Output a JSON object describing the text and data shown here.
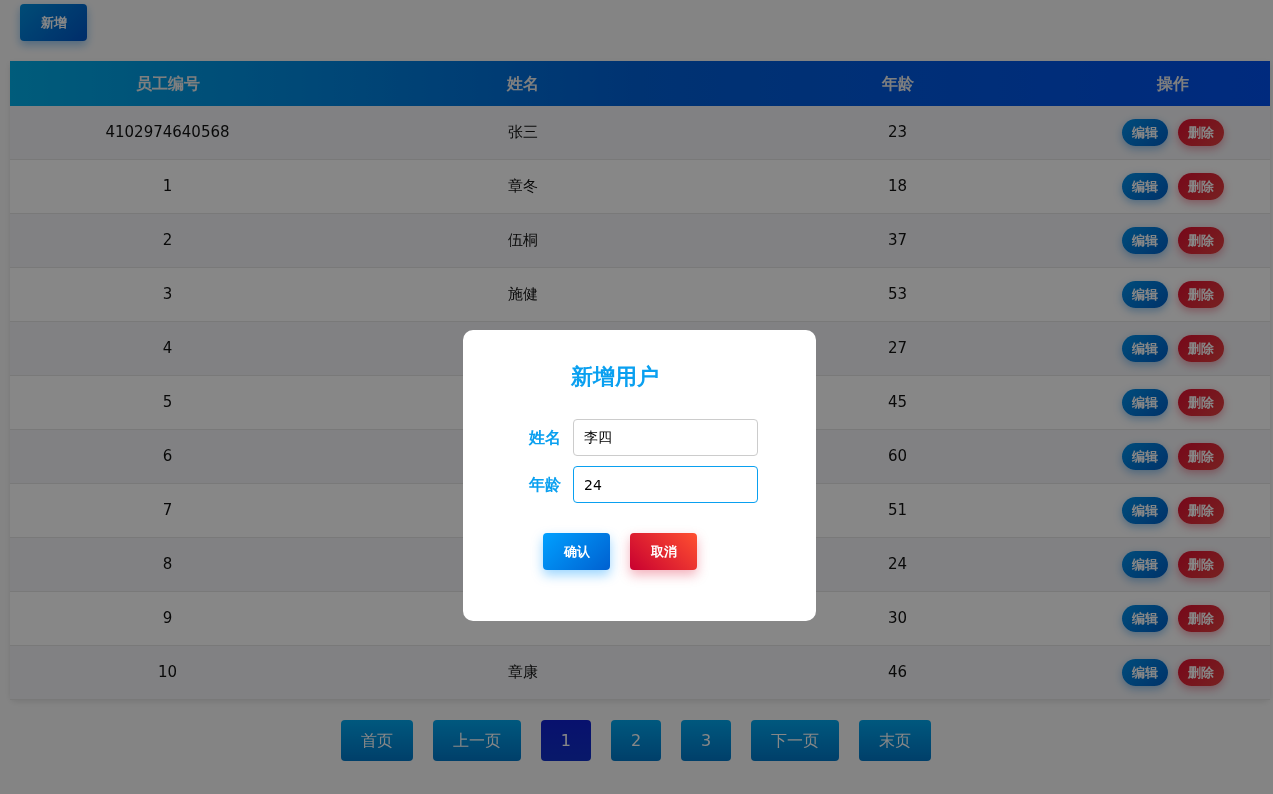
{
  "add_button": "新增",
  "table": {
    "columns": [
      "员工编号",
      "姓名",
      "年龄",
      "操作"
    ],
    "rows": [
      {
        "id": "4102974640568",
        "name": "张三",
        "age": "23",
        "actions": [
          "编辑",
          "删除"
        ]
      },
      {
        "id": "1",
        "name": "章冬",
        "age": "18",
        "actions": [
          "编辑",
          "删除"
        ]
      },
      {
        "id": "2",
        "name": "伍桐",
        "age": "37",
        "actions": [
          "编辑",
          "删除"
        ]
      },
      {
        "id": "3",
        "name": "施健",
        "age": "53",
        "actions": [
          "编辑",
          "删除"
        ]
      },
      {
        "id": "4",
        "age": "27",
        "actions": [
          "编辑",
          "删除"
        ]
      },
      {
        "id": "5",
        "age": "45",
        "actions": [
          "编辑",
          "删除"
        ]
      },
      {
        "id": "6",
        "age": "60",
        "actions": [
          "编辑",
          "删除"
        ]
      },
      {
        "id": "7",
        "age": "51",
        "actions": [
          "编辑",
          "删除"
        ]
      },
      {
        "id": "8",
        "age": "24",
        "actions": [
          "编辑",
          "删除"
        ]
      },
      {
        "id": "9",
        "age": "30",
        "actions": [
          "编辑",
          "删除"
        ]
      },
      {
        "id": "10",
        "name": "章康",
        "age": "46",
        "actions": [
          "编辑",
          "删除"
        ]
      }
    ]
  },
  "pagination": [
    {
      "label": "首页",
      "selected": false
    },
    {
      "label": "上一页",
      "selected": false
    },
    {
      "label": "1",
      "selected": true
    },
    {
      "label": "2",
      "selected": false
    },
    {
      "label": "3",
      "selected": false
    },
    {
      "label": "下一页",
      "selected": false
    },
    {
      "label": "末页",
      "selected": false
    }
  ],
  "dialog": {
    "title": "新增用户",
    "fields": [
      {
        "label": "姓名",
        "kind": "text",
        "value": "李四",
        "focused": false
      },
      {
        "label": "年龄",
        "kind": "number",
        "value": "24",
        "focused": true
      }
    ],
    "buttons": [
      {
        "label": "确认",
        "kind": "confirm"
      },
      {
        "label": "取消",
        "kind": "cancel"
      }
    ]
  }
}
